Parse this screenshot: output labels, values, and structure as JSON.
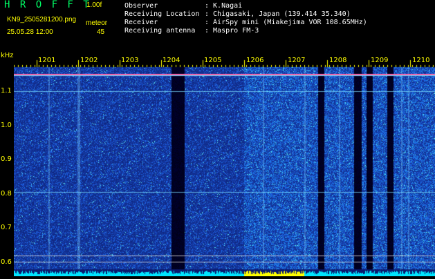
{
  "header": {
    "logo": "H R O F F T",
    "version": "1.00f",
    "filename": "KN9_2505281200.png",
    "datetime": "25.05.28 12:00",
    "meteor_label": "meteor",
    "meteor_count": "45",
    "info": [
      {
        "key": "Observer",
        "value": ": K.Nagai"
      },
      {
        "key": "Receiving Location",
        "value": ": Chigasaki, Japan (139.414 35.340)"
      },
      {
        "key": "Receiver",
        "value": ": AirSpy mini (Miakejima VOR 108.65MHz)"
      },
      {
        "key": "Receiving antenna",
        "value": ": Maspro FM-3"
      }
    ]
  },
  "colors": {
    "header_text": "#ffff00",
    "info_text": "#ffffff",
    "logo": "#00ff66",
    "background": "#000000",
    "noise_dark": "#0a1a6e",
    "noise_bright": "#1d4fd8",
    "baseline": "#00e5ff"
  },
  "waterfall": {
    "y_unit": "kHz",
    "y_ticks": [
      "1.1",
      "1.0",
      "0.9",
      "0.8",
      "0.7",
      "0.6"
    ],
    "x_ticks": [
      "1201",
      "1202",
      "1203",
      "1204",
      "1205",
      "1206",
      "1207",
      "1208",
      "1209",
      "1210"
    ]
  }
}
